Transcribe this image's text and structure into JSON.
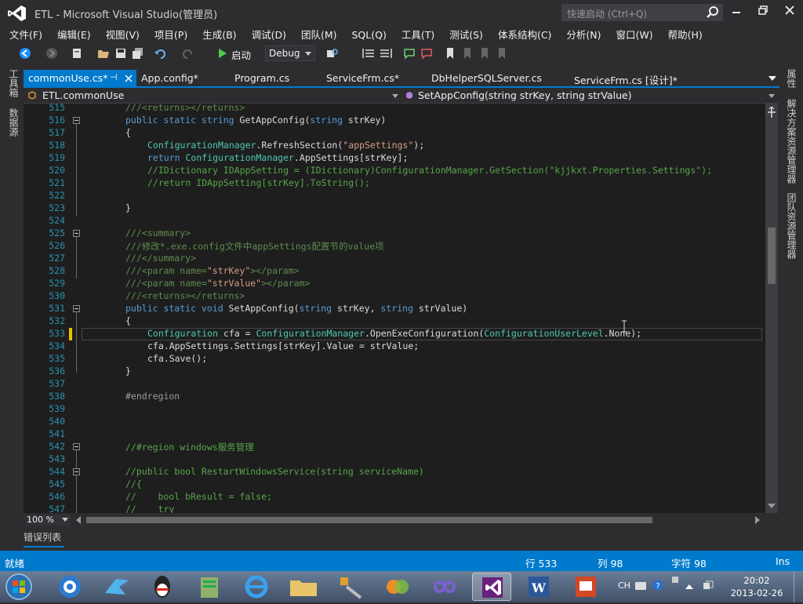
{
  "window": {
    "title": "ETL - Microsoft Visual Studio(管理员)",
    "quick_launch_placeholder": "快速启动 (Ctrl+Q)"
  },
  "menu": [
    "文件(F)",
    "编辑(E)",
    "视图(V)",
    "项目(P)",
    "生成(B)",
    "调试(D)",
    "团队(M)",
    "SQL(Q)",
    "工具(T)",
    "测试(S)",
    "体系结构(C)",
    "分析(N)",
    "窗口(W)",
    "帮助(H)"
  ],
  "toolbar": {
    "start_label": "启动",
    "config_value": "Debug"
  },
  "left_panels": [
    "工具箱",
    "数据源"
  ],
  "right_panels": [
    "属性",
    "解决方案资源管理器",
    "团队资源管理器"
  ],
  "tabs": [
    {
      "label": "commonUse.cs*",
      "active": true
    },
    {
      "label": "App.config*"
    },
    {
      "label": "Program.cs"
    },
    {
      "label": "ServiceFrm.cs*"
    },
    {
      "label": "DbHelperSQLServer.cs"
    },
    {
      "label": "ServiceFrm.cs [设计]*"
    }
  ],
  "nav": {
    "class": "ETL.commonUse",
    "member": "SetAppConfig(string strKey, string strValue)"
  },
  "editor": {
    "line_numbers": [
      "515",
      "516",
      "517",
      "518",
      "519",
      "520",
      "521",
      "522",
      "523",
      "524",
      "525",
      "526",
      "527",
      "528",
      "529",
      "530",
      "531",
      "532",
      "533",
      "534",
      "535",
      "536",
      "537",
      "538",
      "539",
      "540",
      "541",
      "542",
      "543",
      "544",
      "545",
      "546",
      "547"
    ],
    "zoom": "100 %"
  },
  "error_list_label": "错误列表",
  "status": {
    "ready": "就绪",
    "line": "行 533",
    "col": "列 98",
    "char": "字符 98",
    "mode": "Ins"
  },
  "taskbar": {
    "time": "20:02",
    "date": "2013-02-26",
    "ime": "CH"
  },
  "colors": {
    "accent": "#007acc",
    "background": "#2d2d30",
    "editor_bg": "#1e1e1e",
    "line_number": "#2b91af"
  }
}
